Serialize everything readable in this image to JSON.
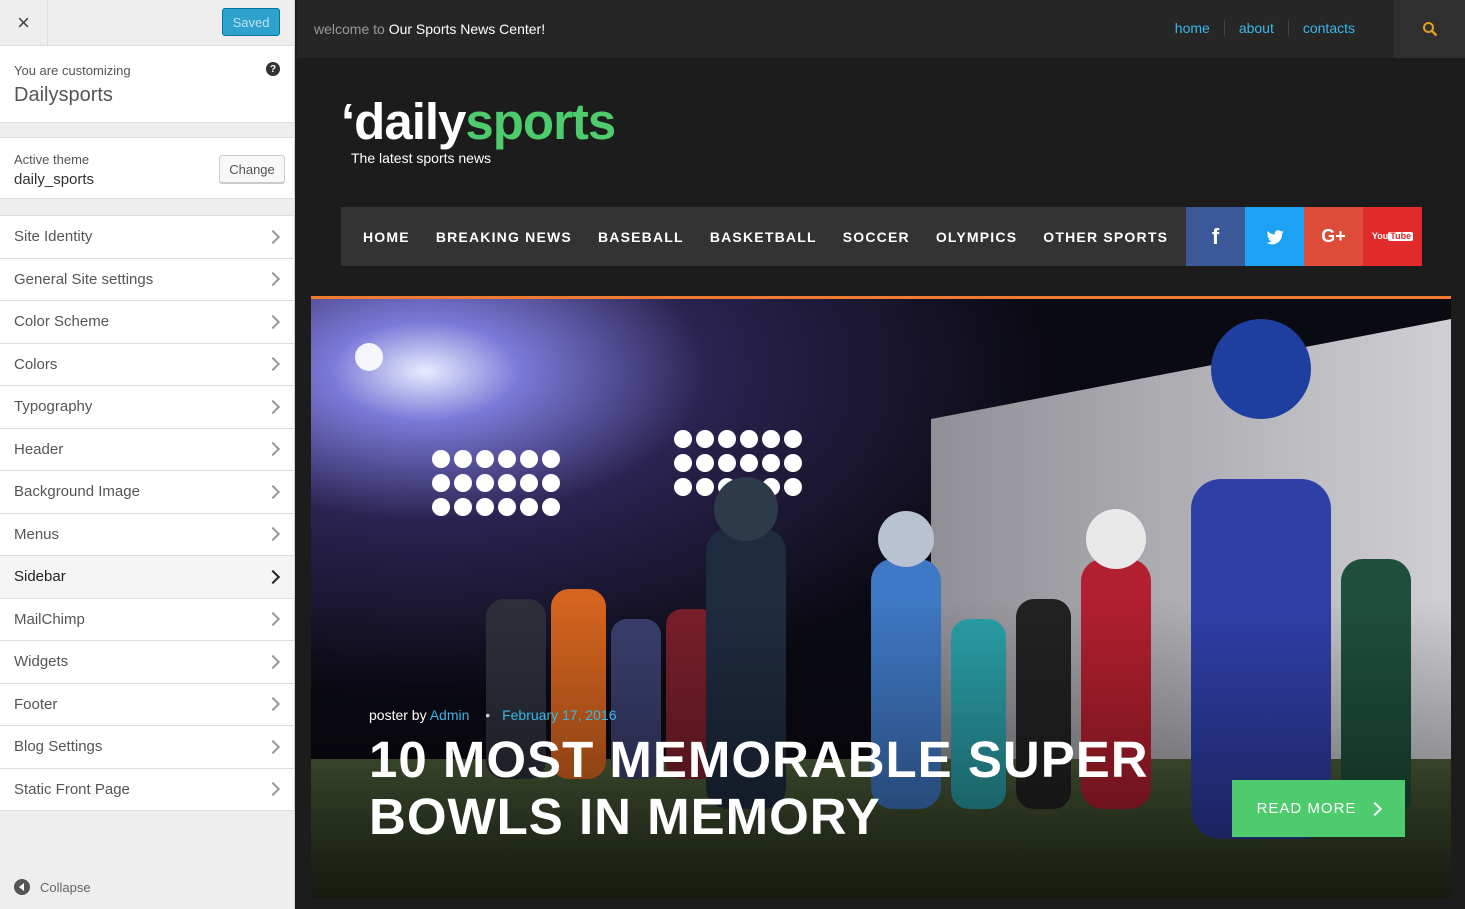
{
  "customizer": {
    "close_label": "×",
    "saved_label": "Saved",
    "customizing_label": "You are customizing",
    "site_name": "Dailysports",
    "help_icon": "?",
    "active_theme_label": "Active theme",
    "active_theme_name": "daily_sports",
    "change_label": "Change",
    "sections": [
      {
        "label": "Site Identity"
      },
      {
        "label": "General Site settings"
      },
      {
        "label": "Color Scheme"
      },
      {
        "label": "Colors"
      },
      {
        "label": "Typography"
      },
      {
        "label": "Header"
      },
      {
        "label": "Background Image"
      },
      {
        "label": "Menus"
      },
      {
        "label": "Sidebar",
        "active": true
      },
      {
        "label": "MailChimp"
      },
      {
        "label": "Widgets"
      },
      {
        "label": "Footer"
      },
      {
        "label": "Blog Settings"
      },
      {
        "label": "Static Front Page"
      }
    ],
    "collapse_label": "Collapse"
  },
  "site": {
    "welcome_prefix": "welcome to",
    "welcome_name": "Our Sports News Center!",
    "top_nav": [
      "home",
      "about",
      "contacts"
    ],
    "logo_quote": "‘",
    "logo_part1": "daily",
    "logo_part2": "sports",
    "tagline": "The latest sports news",
    "main_nav": [
      "HOME",
      "BREAKING NEWS",
      "BASEBALL",
      "BASKETBALL",
      "SOCCER",
      "OLYMPICS",
      "OTHER SPORTS"
    ],
    "social": {
      "facebook": "f",
      "gplus": "G+",
      "youtube_top": "You",
      "youtube_bottom": "Tube"
    },
    "hero": {
      "poster_prefix": "poster by",
      "author": "Admin",
      "separator": "•",
      "date": "February 17, 2016",
      "title": "10 MOST MEMORABLE SUPER BOWLS IN MEMORY",
      "read_more": "READ MORE"
    }
  },
  "colors": {
    "accent_green": "#4ecb6c",
    "link_blue": "#3ab7e8",
    "saved_blue": "#2ea2cc",
    "orange_border": "#f07a32"
  }
}
